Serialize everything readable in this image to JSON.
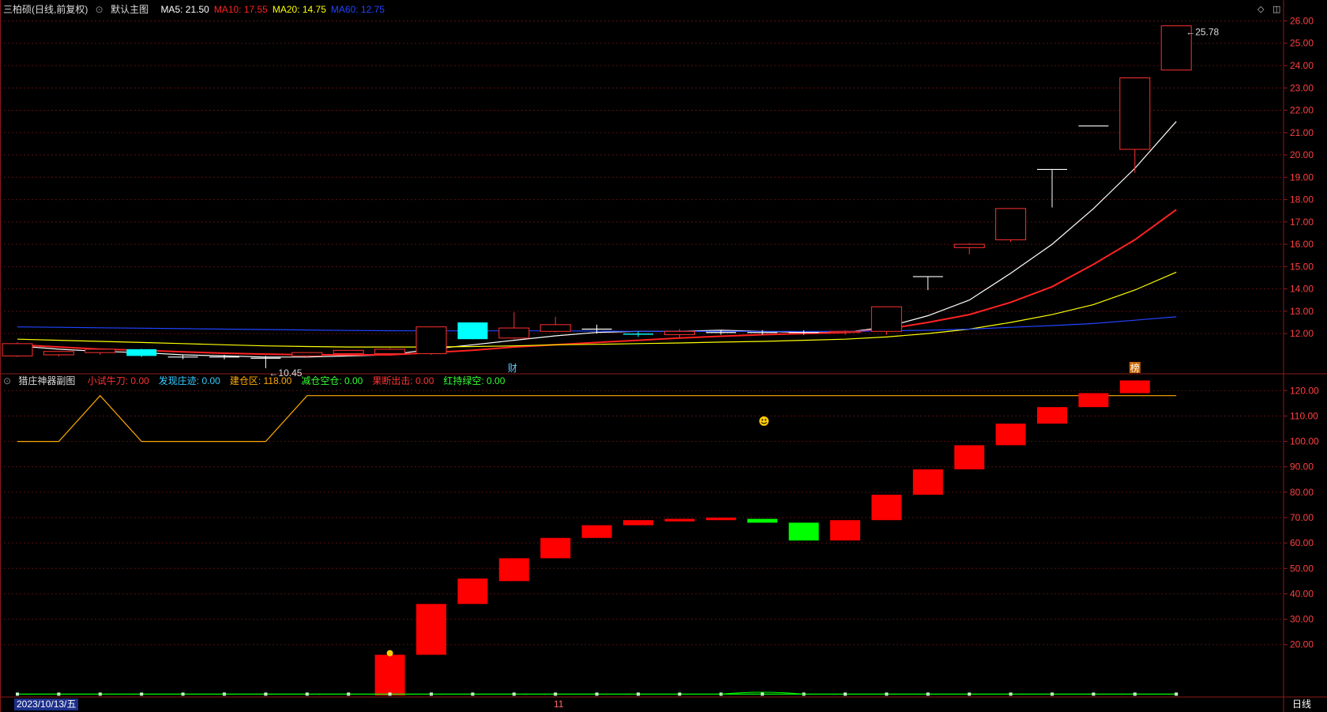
{
  "main": {
    "stock_name": "三柏硕(日线,前复权)",
    "template": "默认主图",
    "ma_legend": [
      {
        "label": "MA5: 21.50",
        "color": "#ffffff"
      },
      {
        "label": "MA10: 17.55",
        "color": "#ff2222"
      },
      {
        "label": "MA20: 14.75",
        "color": "#ffff00"
      },
      {
        "label": "MA60: 12.75",
        "color": "#2244ff"
      }
    ],
    "hi_label": "25.78",
    "lo_label": "10.45",
    "marker_cai": "财",
    "marker_bang": "榜"
  },
  "sub": {
    "title": "猎庄神器副图",
    "legend": [
      {
        "label": "小试牛刀: 0.00",
        "color": "#ff3333"
      },
      {
        "label": "发现庄迹: 0.00",
        "color": "#33ccff"
      },
      {
        "label": "建仓区: 118.00",
        "color": "#ffaa00"
      },
      {
        "label": "减仓空仓: 0.00",
        "color": "#33ff33"
      },
      {
        "label": "果断出击: 0.00",
        "color": "#ff3333"
      },
      {
        "label": "红持绿空: 0.00",
        "color": "#33ff33"
      }
    ]
  },
  "footer": {
    "date": "2023/10/13/五",
    "month_mark": "11",
    "period": "日线"
  },
  "chart_data": [
    {
      "type": "candlestick",
      "y_ticks": [
        "12.00",
        "13.00",
        "14.00",
        "15.00",
        "16.00",
        "17.00",
        "18.00",
        "19.00",
        "20.00",
        "21.00",
        "22.00",
        "23.00",
        "24.00",
        "25.00",
        "26.00"
      ],
      "ylim": [
        10.2,
        26.3
      ],
      "candles": [
        {
          "o": 11.0,
          "h": 11.6,
          "l": 10.95,
          "c": 11.55
        },
        {
          "o": 11.05,
          "h": 11.2,
          "l": 10.98,
          "c": 11.2
        },
        {
          "o": 11.15,
          "h": 11.3,
          "l": 11.05,
          "c": 11.3
        },
        {
          "o": 11.3,
          "h": 11.32,
          "l": 10.95,
          "c": 11.0
        },
        {
          "o": 10.95,
          "h": 11.05,
          "l": 10.85,
          "c": 10.95
        },
        {
          "o": 10.95,
          "h": 11.05,
          "l": 10.85,
          "c": 10.95
        },
        {
          "o": 10.9,
          "h": 11.0,
          "l": 10.45,
          "c": 10.9
        },
        {
          "o": 11.0,
          "h": 11.15,
          "l": 10.9,
          "c": 11.15
        },
        {
          "o": 11.1,
          "h": 11.25,
          "l": 11.0,
          "c": 11.25
        },
        {
          "o": 11.1,
          "h": 11.35,
          "l": 11.05,
          "c": 11.3
        },
        {
          "o": 11.1,
          "h": 12.3,
          "l": 11.05,
          "c": 12.3
        },
        {
          "o": 12.5,
          "h": 12.5,
          "l": 11.75,
          "c": 11.75
        },
        {
          "o": 11.8,
          "h": 12.95,
          "l": 11.75,
          "c": 12.25
        },
        {
          "o": 12.1,
          "h": 12.75,
          "l": 12.05,
          "c": 12.4
        },
        {
          "o": 12.2,
          "h": 12.4,
          "l": 12.0,
          "c": 12.2
        },
        {
          "o": 12.0,
          "h": 12.1,
          "l": 11.85,
          "c": 11.95
        },
        {
          "o": 11.95,
          "h": 12.2,
          "l": 11.8,
          "c": 12.1
        },
        {
          "o": 12.05,
          "h": 12.15,
          "l": 11.95,
          "c": 12.05
        },
        {
          "o": 12.05,
          "h": 12.15,
          "l": 11.95,
          "c": 12.05
        },
        {
          "o": 12.05,
          "h": 12.15,
          "l": 11.95,
          "c": 12.05
        },
        {
          "o": 12.05,
          "h": 12.15,
          "l": 11.95,
          "c": 12.1
        },
        {
          "o": 12.1,
          "h": 13.2,
          "l": 11.95,
          "c": 13.2
        },
        {
          "o": 14.55,
          "h": 14.55,
          "l": 13.95,
          "c": 14.55
        },
        {
          "o": 15.85,
          "h": 16.05,
          "l": 15.55,
          "c": 16.0
        },
        {
          "o": 16.2,
          "h": 17.6,
          "l": 16.1,
          "c": 17.6
        },
        {
          "o": 19.35,
          "h": 19.35,
          "l": 17.65,
          "c": 19.35
        },
        {
          "o": 21.3,
          "h": 21.3,
          "l": 21.3,
          "c": 21.3
        },
        {
          "o": 20.25,
          "h": 23.45,
          "l": 19.2,
          "c": 23.45
        },
        {
          "o": 23.8,
          "h": 25.78,
          "l": 23.8,
          "c": 25.78
        }
      ],
      "ma": [
        {
          "name": "MA5",
          "color": "#ffffff",
          "values": [
            11.45,
            11.3,
            11.2,
            11.15,
            11.05,
            11.0,
            10.95,
            10.95,
            11.0,
            11.05,
            11.3,
            11.5,
            11.7,
            11.9,
            12.05,
            12.1,
            12.1,
            12.15,
            12.1,
            12.05,
            12.05,
            12.3,
            12.8,
            13.5,
            14.7,
            16.0,
            17.6,
            19.4,
            21.5
          ]
        },
        {
          "name": "MA10",
          "color": "#ff2222",
          "values": [
            11.5,
            11.4,
            11.3,
            11.25,
            11.18,
            11.12,
            11.08,
            11.05,
            11.05,
            11.05,
            11.15,
            11.25,
            11.4,
            11.5,
            11.6,
            11.7,
            11.8,
            11.88,
            11.95,
            12.0,
            12.05,
            12.2,
            12.5,
            12.85,
            13.4,
            14.1,
            15.1,
            16.2,
            17.55
          ]
        },
        {
          "name": "MA20",
          "color": "#ffff00",
          "values": [
            11.75,
            11.7,
            11.65,
            11.6,
            11.55,
            11.5,
            11.45,
            11.42,
            11.4,
            11.4,
            11.4,
            11.42,
            11.45,
            11.5,
            11.52,
            11.55,
            11.58,
            11.62,
            11.65,
            11.7,
            11.75,
            11.85,
            12.0,
            12.2,
            12.5,
            12.85,
            13.3,
            13.95,
            14.75
          ]
        },
        {
          "name": "MA60",
          "color": "#2244ff",
          "values": [
            12.3,
            12.28,
            12.26,
            12.24,
            12.22,
            12.2,
            12.18,
            12.16,
            12.14,
            12.13,
            12.12,
            12.12,
            12.12,
            12.12,
            12.11,
            12.1,
            12.1,
            12.1,
            12.1,
            12.1,
            12.1,
            12.12,
            12.15,
            12.2,
            12.28,
            12.36,
            12.45,
            12.6,
            12.75
          ]
        }
      ]
    },
    {
      "type": "bar",
      "y_ticks": [
        "20.00",
        "30.00",
        "40.00",
        "50.00",
        "60.00",
        "70.00",
        "80.00",
        "90.00",
        "100.00",
        "110.00",
        "120.00"
      ],
      "ylim": [
        0,
        126
      ],
      "boxes": [
        {
          "i": 9,
          "from": 0,
          "to": 16,
          "color": "red"
        },
        {
          "i": 10,
          "from": 16,
          "to": 36,
          "color": "red"
        },
        {
          "i": 11,
          "from": 36,
          "to": 46,
          "color": "red"
        },
        {
          "i": 12,
          "from": 45,
          "to": 54,
          "color": "red"
        },
        {
          "i": 13,
          "from": 54,
          "to": 62,
          "color": "red"
        },
        {
          "i": 14,
          "from": 62,
          "to": 67,
          "color": "red"
        },
        {
          "i": 15,
          "from": 67,
          "to": 69,
          "color": "red"
        },
        {
          "i": 16,
          "from": 68.5,
          "to": 69.5,
          "color": "red"
        },
        {
          "i": 17,
          "from": 69,
          "to": 70,
          "color": "red"
        },
        {
          "i": 18,
          "from": 68,
          "to": 69.5,
          "color": "green"
        },
        {
          "i": 19,
          "from": 61,
          "to": 68,
          "color": "green"
        },
        {
          "i": 20,
          "from": 61,
          "to": 69,
          "color": "red"
        },
        {
          "i": 21,
          "from": 69,
          "to": 79,
          "color": "red"
        },
        {
          "i": 22,
          "from": 79,
          "to": 89,
          "color": "red"
        },
        {
          "i": 23,
          "from": 89,
          "to": 98.5,
          "color": "red"
        },
        {
          "i": 24,
          "from": 98.5,
          "to": 107,
          "color": "red"
        },
        {
          "i": 25,
          "from": 107,
          "to": 113.5,
          "color": "red"
        },
        {
          "i": 26,
          "from": 113.5,
          "to": 119,
          "color": "red"
        },
        {
          "i": 27,
          "from": 119,
          "to": 124,
          "color": "red"
        }
      ],
      "line_jiancang": [
        100,
        100,
        118,
        100,
        100,
        100,
        100,
        118,
        118,
        118,
        118,
        118,
        118,
        118,
        118,
        118,
        118,
        118,
        118,
        118,
        118,
        118,
        118,
        118,
        118,
        118,
        118,
        118,
        118
      ]
    }
  ]
}
